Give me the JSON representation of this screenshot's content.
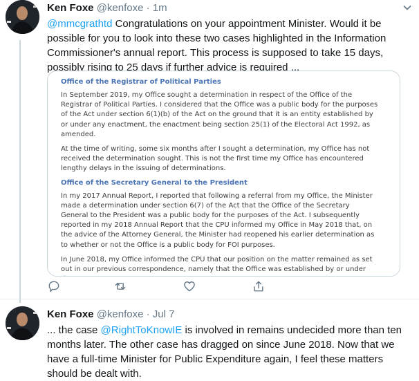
{
  "tweet1": {
    "name": "Ken Foxe",
    "handle": "@kenfoxe",
    "separator": "·",
    "time": "1m",
    "mention": "@mmcgrathtd",
    "text": " Congratulations on your appointment Minister. Would it be possible for you to look into these two cases highlighted in the Information Commissioner's annual report. This process is supposed to take 15 days, possibly rising to 25 days if further advice is required ...",
    "image_doc": {
      "heading1": "Office of the Registrar of Political Parties",
      "para1": "In September 2019, my Office sought a determination in respect of the Office of the Registrar of Political Parties. I considered that the Office was a public body for the purposes of the Act under section 6(1)(b) of the Act on the ground that it is an entity established by or under any enactment, the enactment being section 25(1) of the Electoral Act 1992, as amended.",
      "para2": "At the time of writing, some six months after I sought a determination, my Office has not received the determination sought. This is not the first time my Office has encountered lengthy delays in the issuing of determinations.",
      "heading2": "Office of the Secretary General to the President",
      "para3": "In my 2017 Annual Report, I reported that following a referral from my Office, the Minister made a determination under section 6(7) of the Act that the Office of the Secretary General to the President was a public body for the purposes of the Act.  I subsequently reported in my 2018 Annual Report that the CPU informed my Office in May 2018 that, on the advice of the Attorney General, the Minister had reopened his earlier determination as to whether or not the Office is a public body for FOI purposes.",
      "para4": "In June 2018, my Office informed the CPU that our position on the matter remained as set out in our previous correspondence, namely that the Office was established by or under the"
    }
  },
  "tweet2": {
    "name": "Ken Foxe",
    "handle": "@kenfoxe",
    "separator": "·",
    "time": "Jul 7",
    "text_before": "... the case ",
    "mention": "@RightToKnowIE",
    "text_after": " is involved in remains undecided more than ten months later. The other case has dragged on since June 2018. Now that we have a full-time Minister for Public Expenditure again, I feel these matters should be dealt with."
  },
  "colors": {
    "link": "#1da1f2",
    "meta": "#657786",
    "text": "#14171a",
    "doc_heading": "#4a73b4"
  },
  "icons": [
    "reply-icon",
    "retweet-icon",
    "like-icon",
    "share-icon",
    "caret-down-icon"
  ]
}
